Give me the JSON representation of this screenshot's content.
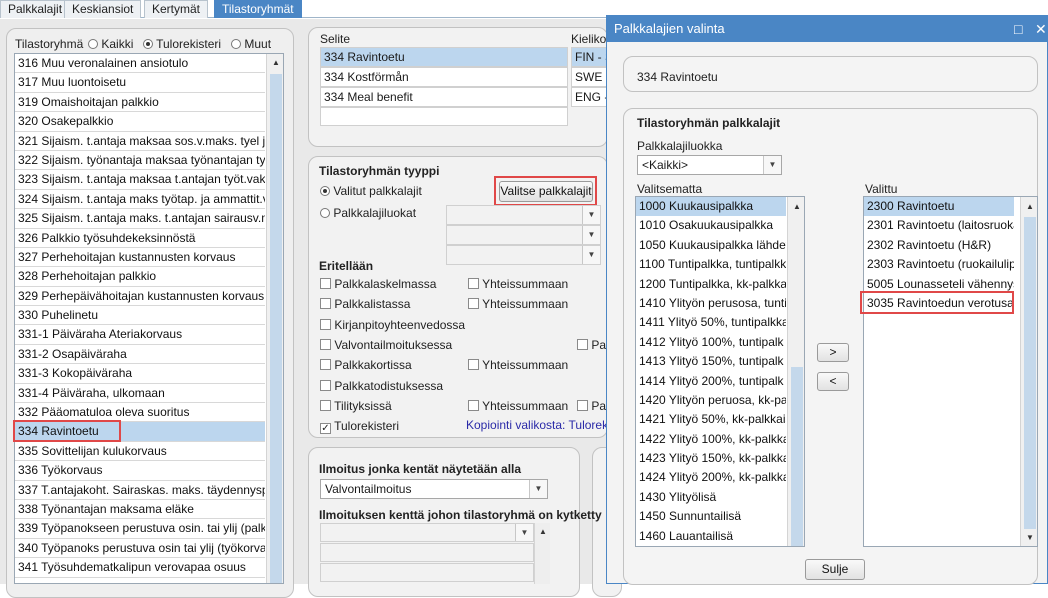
{
  "tabs": [
    "Palkkalajit",
    "Keskiansiot",
    "Kertymät",
    "Tilastoryhmät"
  ],
  "left_panel": {
    "label": "Tilastoryhmä",
    "radio_options": [
      "Kaikki",
      "Tulorekisteri",
      "Muut"
    ],
    "selected_radio": "Tulorekisteri",
    "items": [
      "316 Muu veronalainen ansiotulo",
      "317 Muu  luontoisetu",
      "319 Omaishoitajan palkkio",
      "320 Osakepalkkio",
      "321 Sijaism. t.antaja maksaa sos.v.maks. tyel jn",
      "322 Sijaism. työnantaja maksaa työnantajan tye",
      "323 Sijaism. t.antaja maksaa t.antajan työt.vakn",
      "324 Sijaism. t.antaja maks työtap. ja ammattit.va",
      "325 Sijaism. t.antaja maks. t.antajan sairausv.m",
      "326 Palkkio työsuhdekeksinnöstä",
      "327 Perhehoitajan kustannusten korvaus",
      "328 Perhehoitajan palkkio",
      "329 Perhepäivähoitajan kustannusten korvaus",
      "330 Puhelinetu",
      "331-1 Päiväraha Ateriakorvaus",
      "331-2 Osapäiväraha",
      "331-3 Kokopäiväraha",
      "331-4 Päiväraha, ulkomaan",
      "332 Pääomatuloa oleva suoritus",
      "334 Ravintoetu",
      "335 Sovittelijan kulukorvaus",
      "336 Työkorvaus",
      "337 T.antajakoht. Sairaskas. maks. täydennyspv",
      "338 Työnantajan maksama eläke",
      "339 Työpanokseen perustuva osin. tai ylij (palkk",
      "340 Työpanoks perustuva osin tai ylij (työkorvau",
      "341 Työsuhdematkalipun verovapaa osuus"
    ],
    "selected_item": "334 Ravintoetu"
  },
  "selite": {
    "header": "Selite",
    "header2": "Kieliko",
    "rows": [
      {
        "text": "334 Ravintoetu",
        "lang": "FIN - S"
      },
      {
        "text": "334 Kostförmån",
        "lang": "SWE - S"
      },
      {
        "text": "334 Meal benefit",
        "lang": "ENG -"
      }
    ]
  },
  "tyyppi": {
    "title": "Tilastoryhmän tyyppi",
    "option1": "Valitut palkkalajit",
    "option2": "Palkkalajiluokat",
    "select_button": "Valitse palkkalajit"
  },
  "eritellaan": {
    "title": "Eritellään",
    "items": [
      {
        "label": "Palkkalaskelmassa",
        "checked": false,
        "sum": "Yhteissummaan",
        "extra": ""
      },
      {
        "label": "Palkkalistassa",
        "checked": false,
        "sum": "Yhteissummaan",
        "extra": ""
      },
      {
        "label": "Kirjanpitoyhteenvedossa",
        "checked": false,
        "sum": "",
        "extra": ""
      },
      {
        "label": "Valvontailmoituksessa",
        "checked": false,
        "sum": "",
        "extra": "Pa"
      },
      {
        "label": "Palkkakortissa",
        "checked": false,
        "sum": "Yhteissummaan",
        "extra": ""
      },
      {
        "label": "Palkkatodistuksessa",
        "checked": false,
        "sum": "",
        "extra": ""
      },
      {
        "label": "Tilityksissä",
        "checked": false,
        "sum": "Yhteissummaan",
        "extra": "Pa"
      },
      {
        "label": "Tulorekisteri",
        "checked": true,
        "sum": "",
        "extra": ""
      }
    ],
    "copy_link": "Kopiointi valikosta: Tulorekis"
  },
  "ilmoitus": {
    "label1": "Ilmoitus jonka kentät näytetään alla",
    "value1": "Valvontailmoitus",
    "label2": "Ilmoituksen kenttä johon tilastoryhmä on kytketty"
  },
  "dialog": {
    "title": "Palkkalajien valinta",
    "selected_group": "334 Ravintoetu",
    "section_title": "Tilastoryhmän palkkalajit",
    "class_label": "Palkkalajiluokka",
    "class_value": "<Kaikki>",
    "unselected_label": "Valitsematta",
    "selected_label": "Valittu",
    "unselected": [
      "1000 Kuukausipalkka",
      "1010 Osakuukausipalkka",
      "1050 Kuukausipalkka lähdev",
      "1100 Tuntipalkka, tuntipalkk",
      "1200 Tuntipalkka, kk-palkkai",
      "1410 Ylityön perusosa, tuntip",
      "1411 Ylityö 50%, tuntipalkka",
      "1412 Ylityö 100%, tuntipalk",
      "1413 Ylityö 150%, tuntipalk",
      "1414 Ylityö 200%, tuntipalk",
      "1420 Ylityön peruosa, kk-pal",
      "1421 Ylityö 50%, kk-palkkais",
      "1422 Ylityö 100%, kk-palkka",
      "1423 Ylityö 150%, kk-palkka",
      "1424 Ylityö 200%, kk-palkka",
      "1430 Ylityölisä",
      "1450 Sunnuntailisä",
      "1460 Lauantailisä"
    ],
    "selected": [
      "2300 Ravintoetu",
      "2301 Ravintoetu (laitosruoka",
      "2302 Ravintoetu (H&R)",
      "2303 Ravintoetu (ruokailulip",
      "5005 Lounasseteli vähennys",
      "3035 Ravintoedun verotusar"
    ],
    "add_button": ">",
    "remove_button": "<",
    "close_button": "Sulje"
  }
}
